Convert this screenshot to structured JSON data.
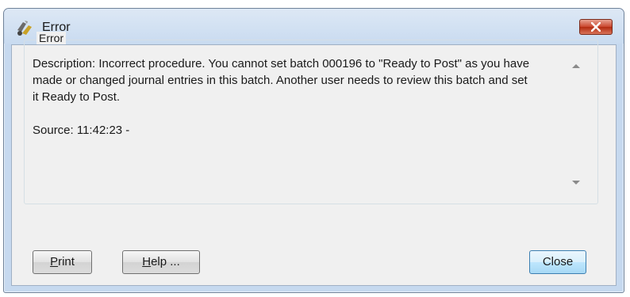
{
  "window": {
    "title": "Error"
  },
  "group": {
    "label": "Error"
  },
  "message": {
    "description": "Description: Incorrect procedure. You cannot set batch 000196 to \"Ready to Post\" as you have made or changed journal entries in this batch. Another user needs to review this batch and set it Ready to Post.",
    "source": "Source:  11:42:23 -"
  },
  "buttons": {
    "print_mnemonic": "P",
    "print_rest": "rint",
    "help_mnemonic": "H",
    "help_rest": "elp ...",
    "close": "Close"
  },
  "colors": {
    "close_button": "#c9452c",
    "window_frame": "#c6d9ef"
  }
}
